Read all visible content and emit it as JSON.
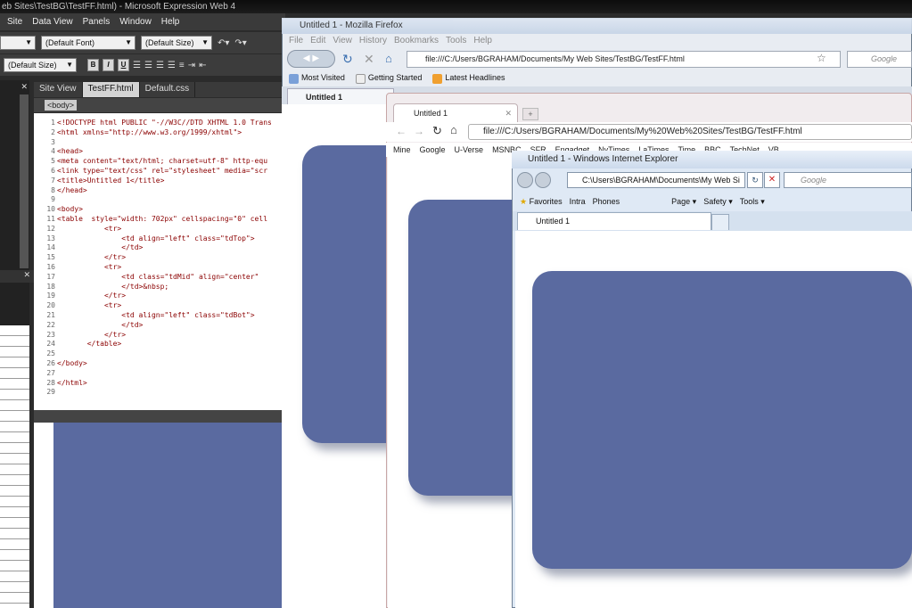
{
  "expression_web": {
    "title": "eb Sites\\TestBG\\TestFF.html) - Microsoft Expression Web 4",
    "menu": [
      "Site",
      "Data View",
      "Panels",
      "Window",
      "Help"
    ],
    "font_combo": "(Default Font)",
    "size_combo": "(Default Size)",
    "style_combo": "(Default Size)",
    "format_buttons": [
      "B",
      "I",
      "U"
    ],
    "tabs": [
      "Site View",
      "TestFF.html",
      "Default.css"
    ],
    "tag_selector": "<body>",
    "code_lines": [
      {
        "n": "1",
        "t": "<!DOCTYPE html PUBLIC \"-//W3C//DTD XHTML 1.0 Trans"
      },
      {
        "n": "2",
        "t": "<html xmlns=\"http://www.w3.org/1999/xhtml\">"
      },
      {
        "n": "3",
        "t": ""
      },
      {
        "n": "4",
        "t": "<head>"
      },
      {
        "n": "5",
        "t": "<meta content=\"text/html; charset=utf-8\" http-equ"
      },
      {
        "n": "6",
        "t": "<link type=\"text/css\" rel=\"stylesheet\" media=\"scr"
      },
      {
        "n": "7",
        "t": "<title>Untitled 1</title>"
      },
      {
        "n": "8",
        "t": "</head>"
      },
      {
        "n": "9",
        "t": ""
      },
      {
        "n": "10",
        "t": "<body>"
      },
      {
        "n": "11",
        "t": "<table  style=\"width: 702px\" cellspacing=\"0\" cell"
      },
      {
        "n": "12",
        "t": "           <tr>"
      },
      {
        "n": "13",
        "t": "               <td align=\"left\" class=\"tdTop\">"
      },
      {
        "n": "14",
        "t": "               </td>"
      },
      {
        "n": "15",
        "t": "           </tr>"
      },
      {
        "n": "16",
        "t": "           <tr>"
      },
      {
        "n": "17",
        "t": "               <td class=\"tdMid\" align=\"center\""
      },
      {
        "n": "18",
        "t": "               </td>&nbsp;"
      },
      {
        "n": "19",
        "t": "           </tr>"
      },
      {
        "n": "20",
        "t": "           <tr>"
      },
      {
        "n": "21",
        "t": "               <td align=\"left\" class=\"tdBot\">"
      },
      {
        "n": "22",
        "t": "               </td>"
      },
      {
        "n": "23",
        "t": "           </tr>"
      },
      {
        "n": "24",
        "t": "       </table>"
      },
      {
        "n": "25",
        "t": ""
      },
      {
        "n": "26",
        "t": "</body>"
      },
      {
        "n": "27",
        "t": ""
      },
      {
        "n": "28",
        "t": "</html>"
      },
      {
        "n": "29",
        "t": ""
      }
    ]
  },
  "firefox": {
    "title": "Untitled 1 - Mozilla Firefox",
    "menu": [
      "File",
      "Edit",
      "View",
      "History",
      "Bookmarks",
      "Tools",
      "Help"
    ],
    "url": "file:///C:/Users/BGRAHAM/Documents/My Web Sites/TestBG/TestFF.html",
    "search_placeholder": "Google",
    "bookmarks": [
      "Most Visited",
      "Getting Started",
      "Latest Headlines"
    ],
    "tab": "Untitled 1"
  },
  "chrome": {
    "tab": "Untitled 1",
    "url": "file:///C:/Users/BGRAHAM/Documents/My%20Web%20Sites/TestBG/TestFF.html",
    "bookmarks": [
      "Mine",
      "Google",
      "U-Verse",
      "MSNBC",
      "SFR",
      "Engadget",
      "NyTimes",
      "LaTimes",
      "Time",
      "BBC",
      "TechNet",
      "VB"
    ]
  },
  "ie": {
    "title": "Untitled 1 - Windows Internet Explorer",
    "url": "C:\\Users\\BGRAHAM\\Documents\\My Web Si",
    "search_placeholder": "Google",
    "command_items": [
      "Favorites",
      "Intra",
      "Phones",
      "Page ▾",
      "Safety ▾",
      "Tools ▾"
    ],
    "tab": "Untitled 1"
  },
  "colors": {
    "box": "#5a6aa0"
  }
}
